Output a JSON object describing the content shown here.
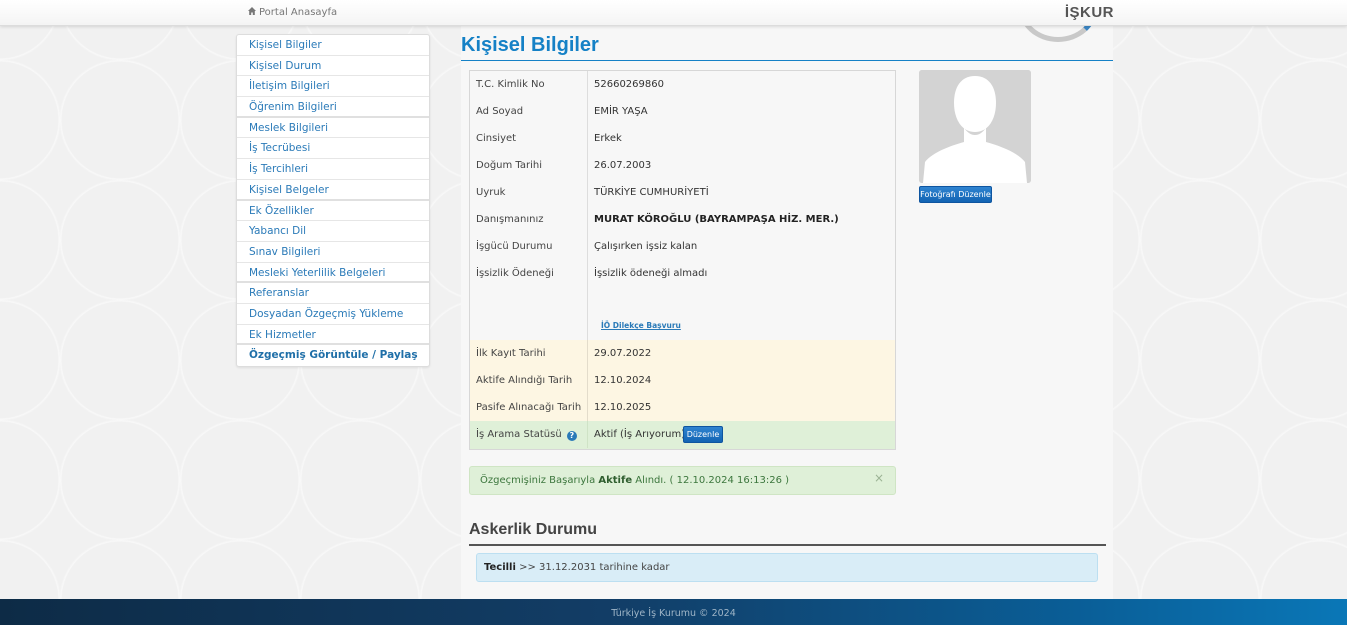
{
  "header": {
    "portal_label": "Portal Anasayfa",
    "brand": "İŞKUR"
  },
  "sidebar": {
    "items": [
      {
        "label": "Kişisel Bilgiler"
      },
      {
        "label": "Kişisel Durum"
      },
      {
        "label": "İletişim Bilgileri"
      },
      {
        "label": "Öğrenim Bilgileri"
      },
      {
        "label": "Meslek Bilgileri"
      },
      {
        "label": "İş Tecrübesi"
      },
      {
        "label": "İş Tercihleri"
      },
      {
        "label": "Kişisel Belgeler"
      },
      {
        "label": "Ek Özellikler"
      },
      {
        "label": "Yabancı Dil"
      },
      {
        "label": "Sınav Bilgileri"
      },
      {
        "label": "Mesleki Yeterlilik Belgeleri"
      },
      {
        "label": "Referanslar"
      },
      {
        "label": "Dosyadan Özgeçmiş Yükleme"
      },
      {
        "label": "Ek Hizmetler"
      },
      {
        "label": "Özgeçmiş Görüntüle / Paylaş"
      }
    ]
  },
  "main": {
    "title": "Kişisel Bilgiler",
    "fields": {
      "tc_label": "T.C. Kimlik No",
      "tc_value": "52660269860",
      "name_label": "Ad Soyad",
      "name_value": "EMİR YAŞA",
      "gender_label": "Cinsiyet",
      "gender_value": "Erkek",
      "birth_label": "Doğum Tarihi",
      "birth_value": "26.07.2003",
      "nation_label": "Uyruk",
      "nation_value": "TÜRKİYE CUMHURİYETİ",
      "advisor_label": "Danışmanınız",
      "advisor_value": "MURAT KÖROĞLU (BAYRAMPAŞA HİZ. MER.)",
      "workforce_label": "İşgücü Durumu",
      "workforce_value": "Çalışırken işsiz kalan",
      "benefit_label": "İşsizlik Ödeneği",
      "benefit_value": "İşsizlik ödeneği almadı",
      "petition_link": "İÖ Dilekçe Başvuru",
      "first_reg_label": "İlk Kayıt Tarihi",
      "first_reg_value": "29.07.2022",
      "active_label": "Aktife Alındığı Tarih",
      "active_value": "12.10.2024",
      "passive_label": "Pasife Alınacağı Tarih",
      "passive_value": "12.10.2025",
      "job_status_label": "İş Arama Statüsü",
      "job_status_value": "Aktif (İş Arıyorum)",
      "edit_button": "Düzenle"
    },
    "photo_button": "Fotoğrafı Düzenle",
    "alert": {
      "prefix": "Özgeçmişiniz Başarıyla ",
      "bold": "Aktife",
      "suffix": " Alındı. ( 12.10.2024 16:13:26 )",
      "close": "×"
    },
    "military": {
      "title": "Askerlik Durumu",
      "status": "Tecilli",
      "detail": " >> 31.12.2031 tarihine kadar"
    }
  },
  "footer": {
    "text": "Türkiye İş Kurumu © 2024"
  }
}
